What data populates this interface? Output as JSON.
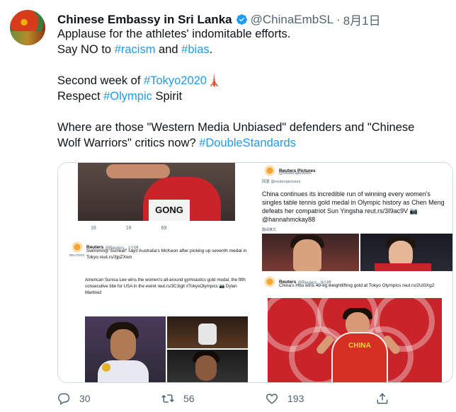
{
  "tweet": {
    "author_name": "Chinese Embassy in Sri Lanka",
    "handle": "@ChinaEmbSL",
    "separator": "·",
    "date": "8月1日",
    "lines": {
      "l1": "Applause for the athletes' indomitable efforts.",
      "l2_pre": "Say NO to ",
      "l2_tag1": "#racism",
      "l2_mid": " and ",
      "l2_tag2": "#bias",
      "l2_end": ".",
      "l3_pre": "Second week of ",
      "l3_tag": "#Tokyo2020",
      "l3_emoji": "🗼",
      "l4_pre": "Respect ",
      "l4_tag": "#Olympic",
      "l4_post": " Spirit",
      "l5_pre": "Where are those \"Western Media Unbiased\" defenders and \"Chinese Wolf Warriors\" critics now?  ",
      "l5_tag": "#DoubleStandards"
    }
  },
  "media": {
    "q1": {
      "bib": "GONG",
      "stats": [
        "16",
        "16",
        "69"
      ],
      "account": "Reuters",
      "account_sub": "@Reuters · 1小时",
      "text": "Swimming-'Surreal!' says Australia's McKeon after picking up seventh medal in Tokyo reut.rs/3jpZXwn",
      "logo_label": "REUTERS"
    },
    "q2": {
      "account": "Reuters Pictures",
      "account_sub": "@reuterspictures",
      "reply": "回复 @reuterspictures",
      "text": "China continues its incredible run of winning every women's singles table tennis gold medal in Olympic history as Chen Meng defeats her compatriot Sun Yingsha reut.rs/3I9ac9V 📷 @hannahmckay88",
      "translate": "翻译推文"
    },
    "q3": {
      "text1": "American Sunisa Lee wins the women's all-around gymnastics gold medal, the fifth consecutive title for USA in the event reut.rs/3C3igit #TokyoOlympics 📷 Dylan Martinez"
    },
    "q4": {
      "account": "Reuters",
      "account_sub": "@Reuters · 9小时",
      "text": "China's Hou wins 49-kg weightlifting gold at Tokyo Olympics reut.rs/2Ul3Xg2",
      "shirt_text": "CHINA"
    }
  },
  "actions": {
    "reply_count": "30",
    "retweet_count": "56",
    "like_count": "193"
  },
  "colors": {
    "link": "#1d9bf0",
    "muted": "#536471",
    "text": "#0f1419"
  }
}
